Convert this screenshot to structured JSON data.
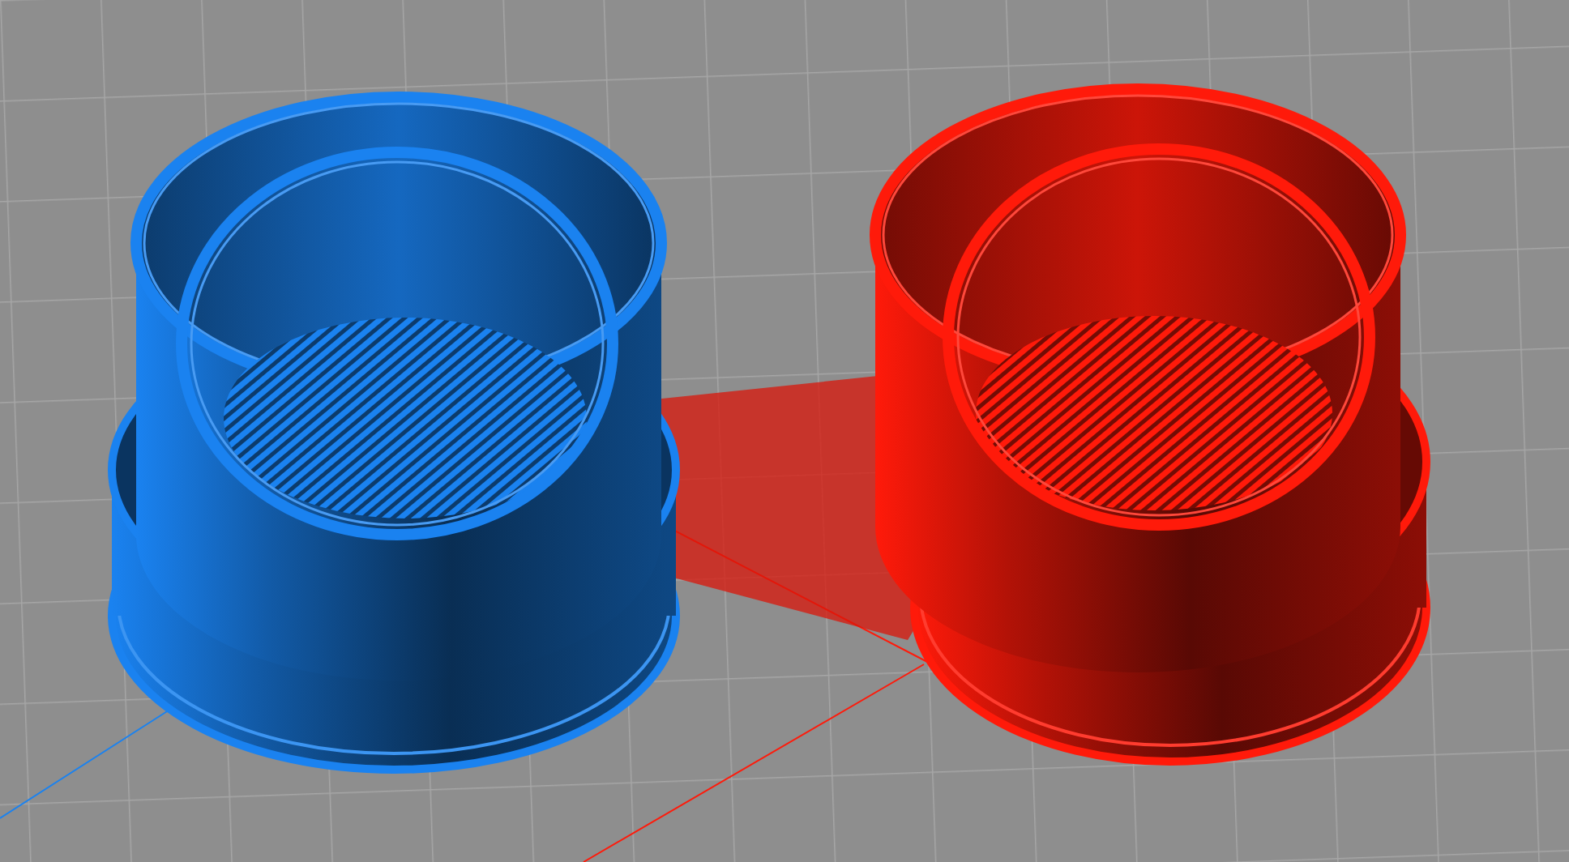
{
  "objects": [
    {
      "color": "#1a82f0"
    },
    {
      "color": "#ff1a0a"
    }
  ]
}
